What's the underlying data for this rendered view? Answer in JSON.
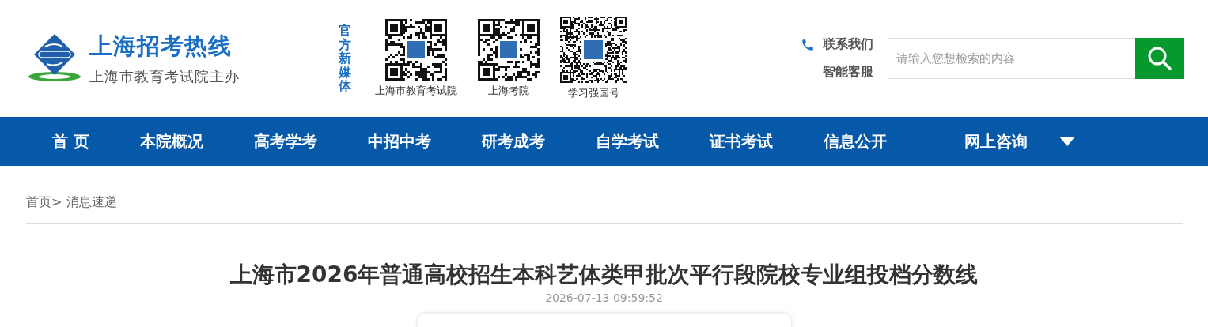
{
  "header": {
    "site_title": "上海招考热线",
    "site_subtitle": "上海市教育考试院主办",
    "media_label": "官方新媒体",
    "qr_codes": [
      {
        "caption": "上海市教育考试院"
      },
      {
        "caption": "上海考院"
      },
      {
        "caption": "学习强国号"
      }
    ],
    "contact": {
      "label": "联系我们",
      "service": "智能客服"
    },
    "search": {
      "placeholder": "请输入您想检索的内容"
    }
  },
  "nav": {
    "items": [
      {
        "label": "首 页"
      },
      {
        "label": "本院概况"
      },
      {
        "label": "高考学考"
      },
      {
        "label": "中招中考"
      },
      {
        "label": "研考成考"
      },
      {
        "label": "自学考试"
      },
      {
        "label": "证书考试"
      },
      {
        "label": "信息公开"
      },
      {
        "label": "网上咨询"
      }
    ]
  },
  "breadcrumb": {
    "home": "首页>",
    "current": "消息速递"
  },
  "article": {
    "title": "上海市2026年普通高校招生本科艺体类甲批次平行段院校专业组投档分数线",
    "date": "2026-07-13 09:59:52"
  }
}
